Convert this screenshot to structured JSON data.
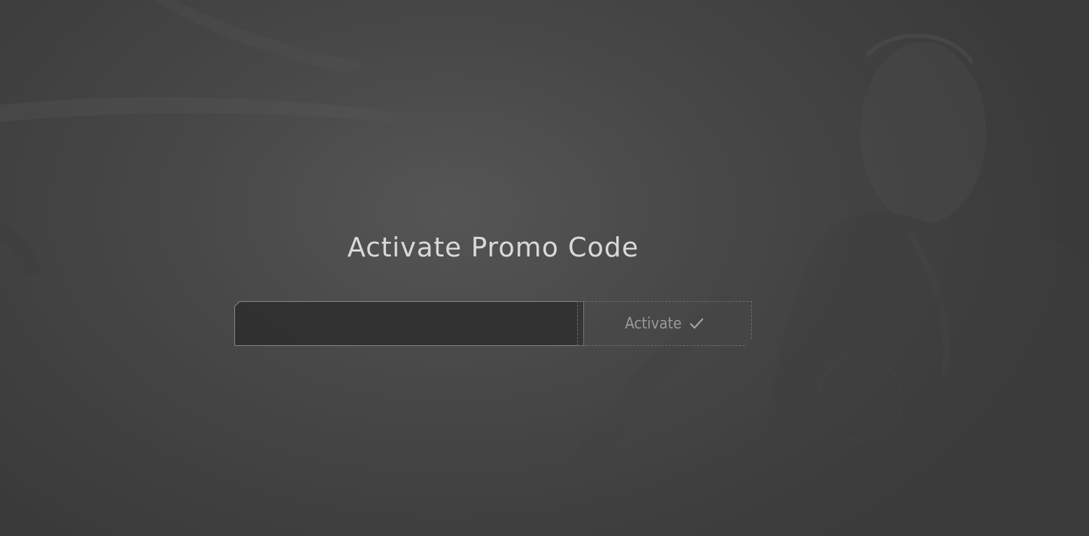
{
  "page": {
    "title": "Activate Promo Code"
  },
  "promo": {
    "input_value": "",
    "input_placeholder": "",
    "activate_label": "Activate",
    "activate_icon": "checkmark-icon"
  },
  "colors": {
    "background": "#474747",
    "title_text": "#d9d9d9",
    "input_border": "#8a8a8a",
    "button_text": "#9a9a9a"
  }
}
